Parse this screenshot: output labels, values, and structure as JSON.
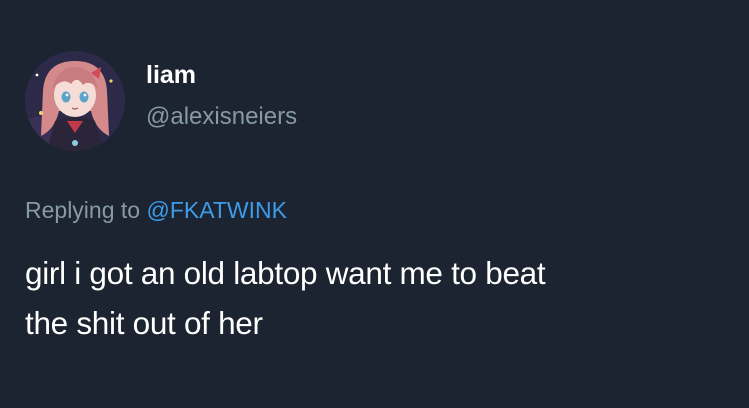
{
  "colors": {
    "background": "#1b2430",
    "text_primary": "#ffffff",
    "text_secondary": "#8899a6",
    "link": "#3d9be9"
  },
  "author": {
    "avatar_icon": "avatar-image-anime-character",
    "name": "liam",
    "handle": "@alexisneiers"
  },
  "reply_context": {
    "prefix": "Replying to",
    "mention": "@FKATWINK"
  },
  "tweet": {
    "line1": "girl i got an old labtop want me to beat",
    "line2": "the shit out of her"
  }
}
